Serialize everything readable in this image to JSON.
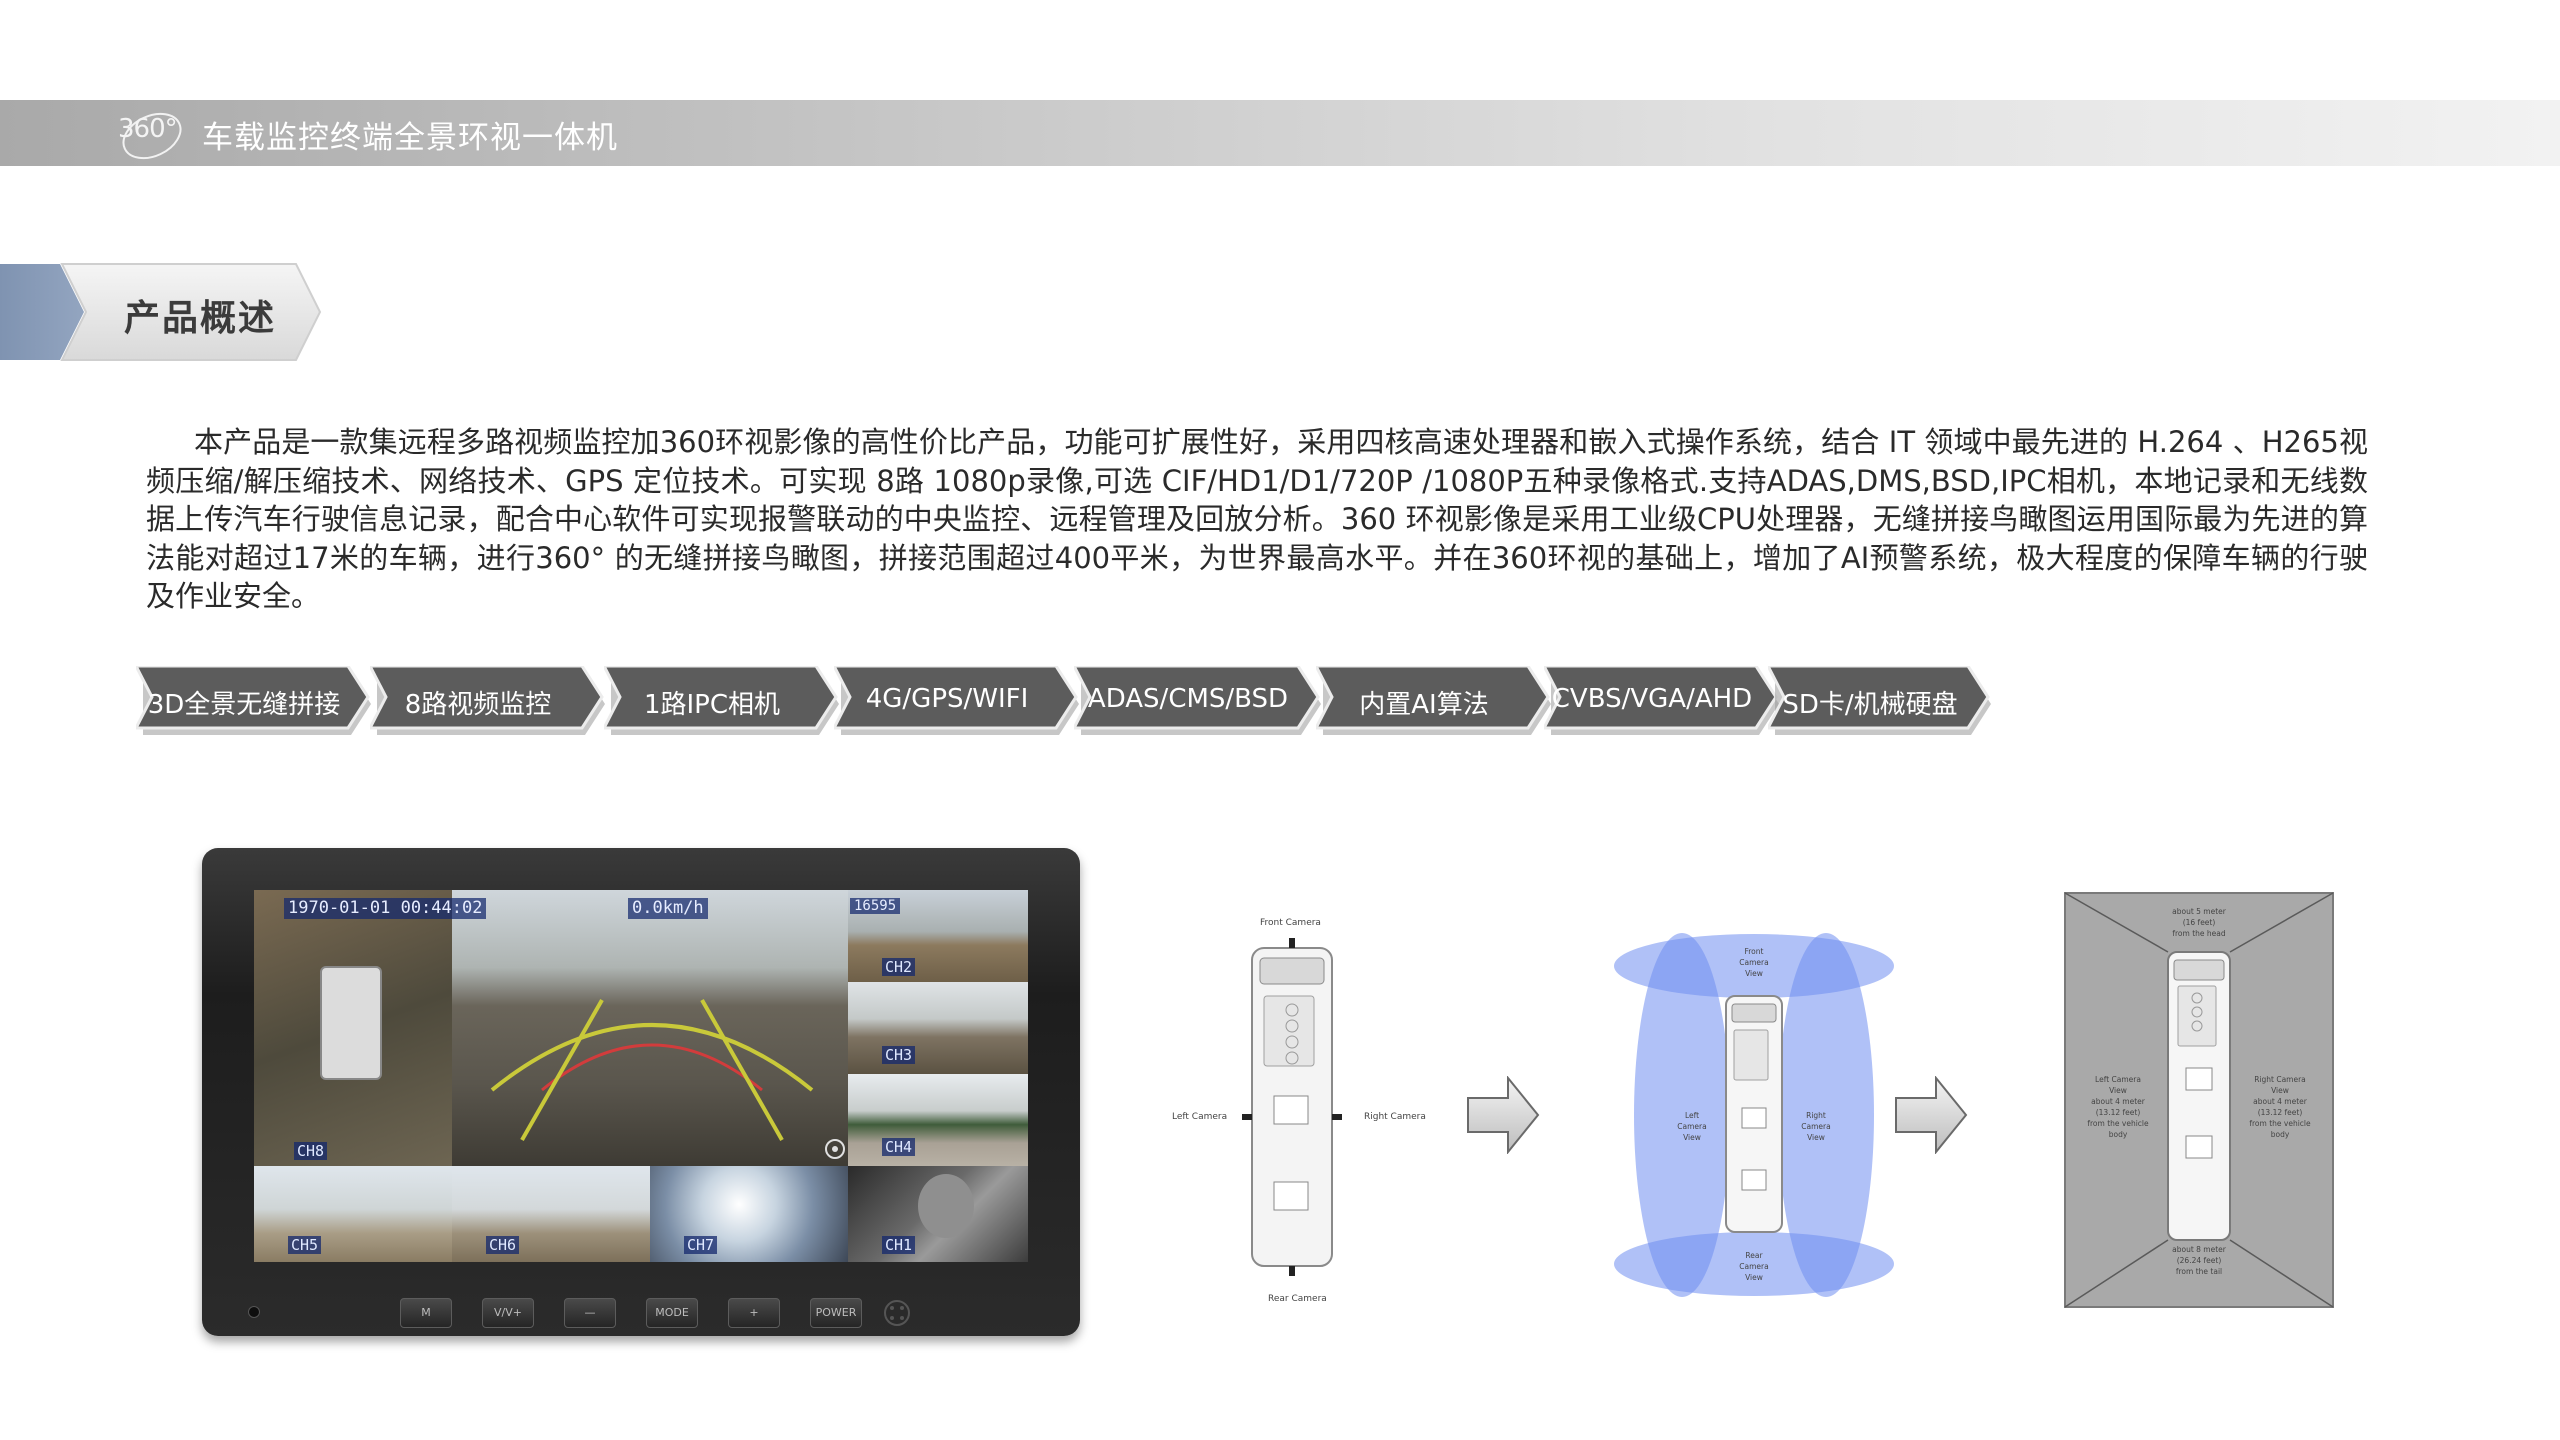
{
  "header": {
    "logo_text": "360°",
    "title": "车载监控终端全景环视一体机"
  },
  "section": {
    "title": "产品概述"
  },
  "description": "本产品是一款集远程多路视频监控加360环视影像的高性价比产品，功能可扩展性好，采用四核高速处理器和嵌入式操作系统，结合 IT 领域中最先进的 H.264 、H265视频压缩/解压缩技术、网络技术、GPS 定位技术。可实现 8路 1080p录像,可选 CIF/HD1/D1/720P /1080P五种录像格式.支持ADAS,DMS,BSD,IPC相机，本地记录和无线数据上传汽车行驶信息记录，配合中心软件可实现报警联动的中央监控、远程管理及回放分析。360 环视影像是采用工业级CPU处理器，无缝拼接鸟瞰图运用国际最为先进的算法能对超过17米的车辆，进行360° 的无缝拼接鸟瞰图，拼接范围超过400平米，为世界最高水平。并在360环视的基础上，增加了AI预警系统，极大程度的保障车辆的行驶及作业安全。",
  "features": [
    "3D全景无缝拼接",
    "8路视频监控",
    "1路IPC相机",
    "4G/GPS/WIFI",
    "ADAS/CMS/BSD",
    "内置AI算法",
    "CVBS/VGA/AHD",
    "SD卡/机械硬盘"
  ],
  "monitor": {
    "timestamp": "1970-01-01 00:44:02",
    "speed": "0.0km/h",
    "small_osd": "16595",
    "channels": {
      "ch8": "CH8",
      "ch2": "CH2",
      "ch3": "CH3",
      "ch4": "CH4",
      "ch5": "CH5",
      "ch6": "CH6",
      "ch7": "CH7",
      "ch1": "CH1"
    },
    "buttons": [
      "M",
      "V/V+",
      "—",
      "MODE",
      "+",
      "POWER"
    ]
  },
  "diagram1": {
    "front": "Front Camera",
    "left": "Left Camera",
    "right": "Right Camera",
    "rear": "Rear Camera"
  },
  "diagram2": {
    "front": [
      "Front",
      "Camera",
      "View"
    ],
    "left": [
      "Left",
      "Camera",
      "View"
    ],
    "right": [
      "Right",
      "Camera",
      "View"
    ],
    "rear": [
      "Rear",
      "Camera",
      "View"
    ]
  },
  "diagram3": {
    "head": [
      "about 5 meter",
      "(16 feet)",
      "from the head"
    ],
    "left": [
      "Left Camera",
      "View",
      "about 4 meter",
      "(13.12 feet)",
      "from the vehicle",
      "body"
    ],
    "right": [
      "Right Camera",
      "View",
      "about 4 meter",
      "(13.12 feet)",
      "from the vehicle",
      "body"
    ],
    "tail": [
      "about 8 meter",
      "(26.24 feet)",
      "from the tail"
    ]
  },
  "colors": {
    "tag_fill": "#5c5c5c",
    "topbar": "#b9b9b9",
    "section_accent": "#8196b4",
    "coverage_blue": "#6f8ef0"
  }
}
